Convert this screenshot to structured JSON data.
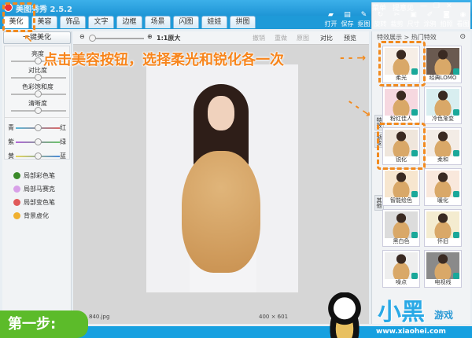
{
  "app": {
    "title": "美图秀秀 2.5.2",
    "menu": "菜单",
    "feedback": "提意见",
    "controls": [
      "—",
      "❐",
      "✕"
    ]
  },
  "tabs": [
    {
      "label": "美化",
      "active": true
    },
    {
      "label": "美容"
    },
    {
      "label": "饰品"
    },
    {
      "label": "文字"
    },
    {
      "label": "边框"
    },
    {
      "label": "场景"
    },
    {
      "label": "闪图",
      "badge": "4"
    },
    {
      "label": "娃娃"
    },
    {
      "label": "拼图"
    }
  ],
  "toolbar": [
    {
      "label": "打开",
      "icon": "▰"
    },
    {
      "label": "保存",
      "icon": "▤"
    },
    {
      "label": "抠图",
      "icon": "✎"
    },
    {
      "label": "旋转",
      "icon": "↻"
    },
    {
      "label": "裁剪",
      "icon": "✂"
    },
    {
      "label": "尺寸",
      "icon": "▣"
    },
    {
      "label": "涂鸦",
      "icon": "✐"
    },
    {
      "label": "拍照",
      "icon": "◙"
    },
    {
      "label": "看图",
      "icon": "◉"
    }
  ],
  "left": {
    "one_click": "一键美化",
    "sliders": [
      "亮度",
      "对比度",
      "色彩饱和度",
      "清晰度"
    ],
    "color_sliders": [
      {
        "l": "青",
        "r": "红",
        "c1": "#5bb8d8",
        "c2": "#d86a6a"
      },
      {
        "l": "紫",
        "r": "绿",
        "c1": "#b266d8",
        "c2": "#6cc46c"
      },
      {
        "l": "黄",
        "r": "蓝",
        "c1": "#e8d85a",
        "c2": "#4a8ad8"
      }
    ],
    "tools": [
      {
        "label": "局部彩色笔",
        "color": "#3a8a2a"
      },
      {
        "label": "局部马赛克",
        "color": "#d8a0e8"
      },
      {
        "label": "局部变色笔",
        "color": "#e05a5a"
      },
      {
        "label": "背景虚化",
        "color": "#f0b030"
      }
    ]
  },
  "center": {
    "zoom_label": "1:1原大",
    "undo": "撤销",
    "redo": "重做",
    "original": "原图",
    "compare": "对比",
    "preview": "预览",
    "filename": "840.jpg",
    "dimensions": "400 × 601"
  },
  "right": {
    "breadcrumb": "特效展示 > 热门特效",
    "vtabs": [
      "特效",
      "渐变",
      "其他"
    ],
    "effects": [
      "柔光",
      "经典LOMO",
      "粉红佳人",
      "冷色渐变",
      "锐化",
      "柔和",
      "智能绘色",
      "暖化",
      "黑白色",
      "怀旧",
      "噪点",
      "电视线"
    ]
  },
  "overlay": {
    "callout": "点击美容按钮，选择柔光和锐化各一次",
    "step": "第一步:",
    "logo_main": "小黑",
    "logo_sub": "游戏",
    "logo_url": "www.xiaohei.com"
  }
}
